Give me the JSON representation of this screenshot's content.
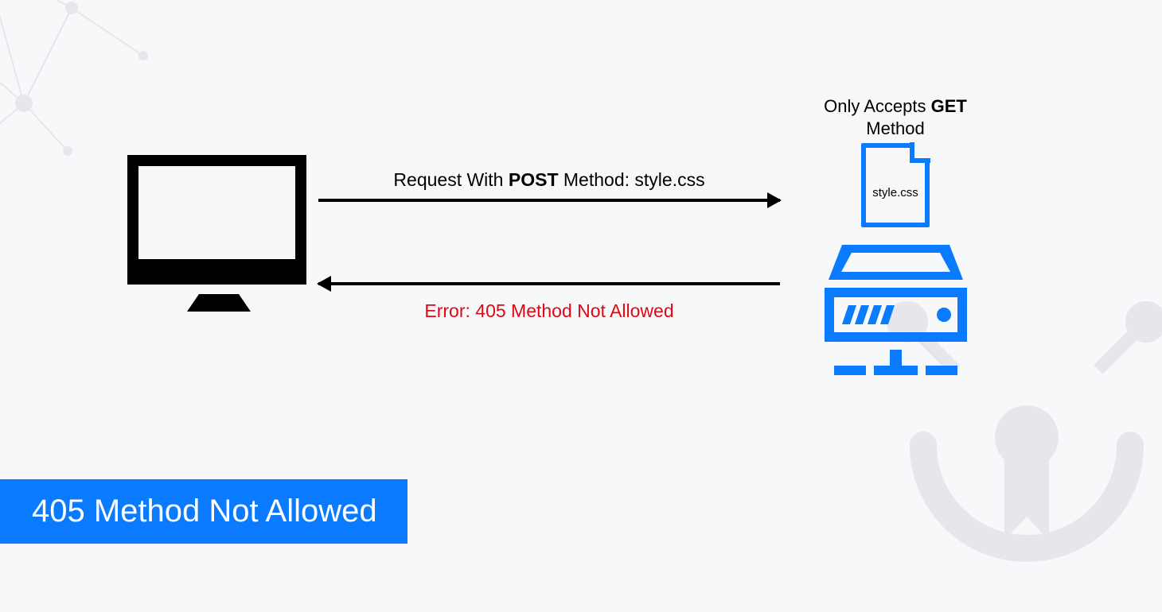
{
  "accepts": {
    "line1_pre": "Only Accepts ",
    "line1_bold": "GET",
    "line2": "Method"
  },
  "file": {
    "name": "style.css"
  },
  "request": {
    "pre": "Request With ",
    "bold": "POST",
    "post": " Method: style.css"
  },
  "error": {
    "text": "Error: 405 Method Not Allowed"
  },
  "title": "405 Method Not Allowed",
  "colors": {
    "accent": "#0a7aff",
    "error": "#e30613",
    "bg": "#f6f8fa",
    "deco": "#e5e7ea"
  }
}
